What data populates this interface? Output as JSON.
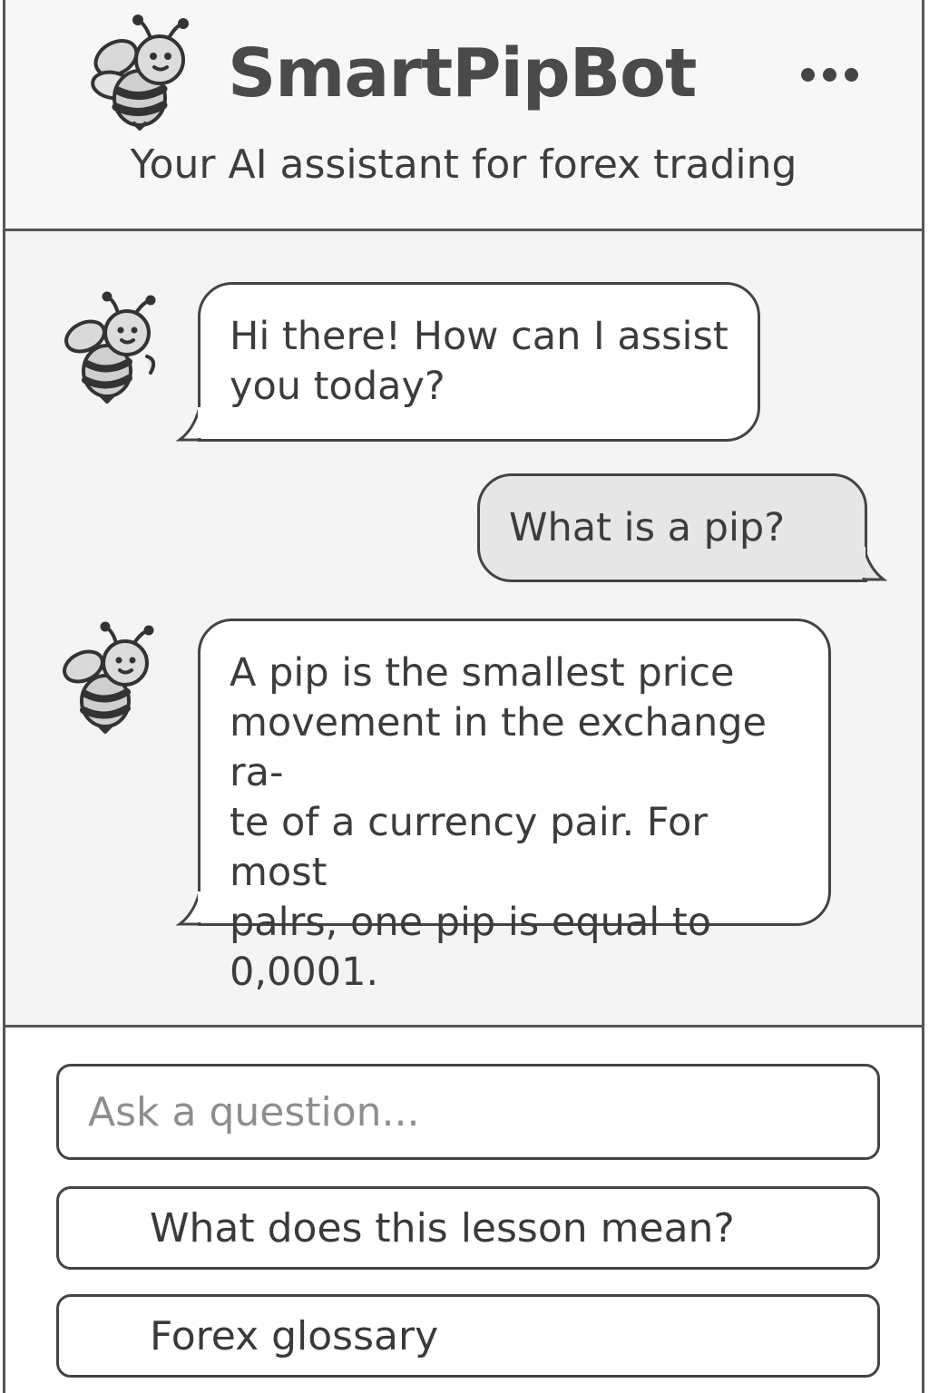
{
  "header": {
    "title": "SmartPipBot",
    "subtitle": "Your AI assistant for forex trading",
    "menu_icon": "more-horizontal-icon",
    "logo_icon": "bee-icon"
  },
  "messages": [
    {
      "sender": "bot",
      "text": "Hi there! How can I assist\nyou today?"
    },
    {
      "sender": "user",
      "text": "What is a pip?"
    },
    {
      "sender": "bot",
      "text": "A pip is the smallest price\nmovement in the exchange ra-\nte of a currency pair. For most\npalrs, one pip is equal to\n0,0001."
    }
  ],
  "input": {
    "placeholder": "Ask a question...",
    "value": ""
  },
  "suggestions": [
    "What does this lesson mean?",
    "Forex glossary"
  ],
  "colors": {
    "border": "#444444",
    "header_bg": "#f7f7f7",
    "chat_bg": "#f4f4f4",
    "bot_bubble": "#ffffff",
    "user_bubble": "#e6e6e6"
  }
}
